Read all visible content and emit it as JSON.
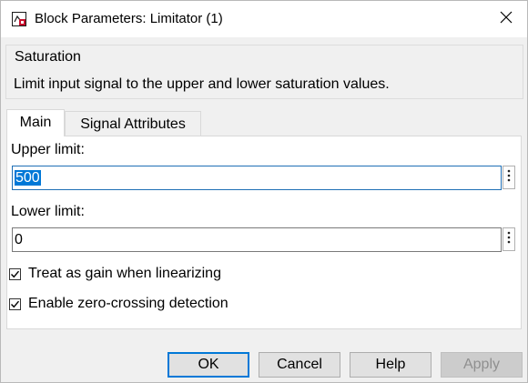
{
  "window": {
    "title": "Block Parameters: Limitator (1)",
    "app_icon": "simulink-block-icon",
    "close_icon": "close-icon"
  },
  "group": {
    "title": "Saturation",
    "description": "Limit input signal to the upper and lower saturation values."
  },
  "tabs": [
    {
      "label": "Main",
      "active": true
    },
    {
      "label": "Signal Attributes",
      "active": false
    }
  ],
  "fields": {
    "upper_limit": {
      "label": "Upper limit:",
      "value": "500",
      "selected": true
    },
    "lower_limit": {
      "label": "Lower limit:",
      "value": "0"
    },
    "more_icon": "vertical-ellipsis-icon"
  },
  "checkboxes": [
    {
      "label": "Treat as gain when linearizing",
      "checked": true
    },
    {
      "label": "Enable zero-crossing detection",
      "checked": true
    }
  ],
  "buttons": {
    "ok": "OK",
    "cancel": "Cancel",
    "help": "Help",
    "apply": "Apply"
  },
  "colors": {
    "accent": "#0078d7",
    "dialog_bg": "#f0f0f0",
    "panel_bg": "#ffffff"
  }
}
